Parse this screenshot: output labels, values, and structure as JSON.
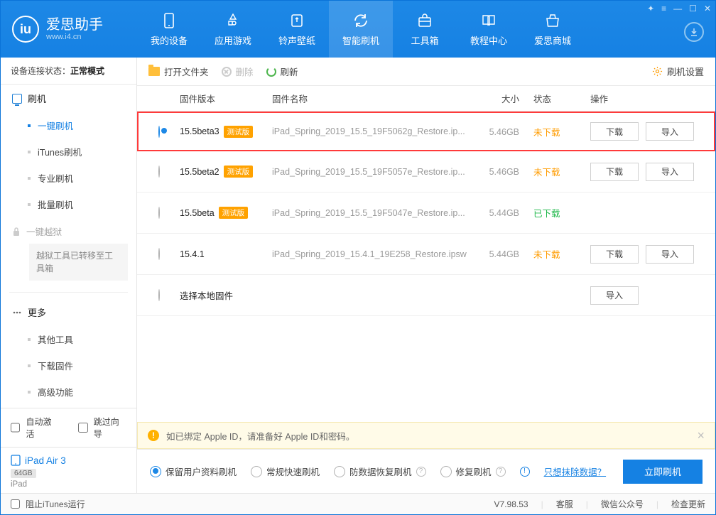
{
  "brand": {
    "cn": "爱思助手",
    "url": "www.i4.cn"
  },
  "nav": {
    "items": [
      {
        "id": "device",
        "label": "我的设备"
      },
      {
        "id": "apps",
        "label": "应用游戏"
      },
      {
        "id": "ring",
        "label": "铃声壁纸"
      },
      {
        "id": "flash",
        "label": "智能刷机"
      },
      {
        "id": "tools",
        "label": "工具箱"
      },
      {
        "id": "tutorial",
        "label": "教程中心"
      },
      {
        "id": "store",
        "label": "爱思商城"
      }
    ],
    "active": "flash"
  },
  "sidebar": {
    "conn_label": "设备连接状态：",
    "conn_value": "正常模式",
    "flash_group": "刷机",
    "items": [
      {
        "id": "onekey",
        "label": "一键刷机"
      },
      {
        "id": "itunes",
        "label": "iTunes刷机"
      },
      {
        "id": "pro",
        "label": "专业刷机"
      },
      {
        "id": "batch",
        "label": "批量刷机"
      }
    ],
    "jailbreak": "一键越狱",
    "jb_note": "越狱工具已转移至工具箱",
    "more": "更多",
    "more_items": [
      {
        "id": "other",
        "label": "其他工具"
      },
      {
        "id": "dlfw",
        "label": "下载固件"
      },
      {
        "id": "adv",
        "label": "高级功能"
      }
    ]
  },
  "auto": {
    "activate": "自动激活",
    "skip": "跳过向导"
  },
  "device": {
    "name": "iPad Air 3",
    "cap": "64GB",
    "model": "iPad"
  },
  "toolbar": {
    "open": "打开文件夹",
    "delete": "删除",
    "refresh": "刷新",
    "settings": "刷机设置"
  },
  "table": {
    "headers": {
      "ver": "固件版本",
      "name": "固件名称",
      "size": "大小",
      "status": "状态",
      "ops": "操作"
    },
    "op_download": "下载",
    "op_import": "导入",
    "local_select": "选择本地固件",
    "badge_beta": "测试版",
    "rows": [
      {
        "ver": "15.5beta3",
        "beta": true,
        "name": "iPad_Spring_2019_15.5_19F5062g_Restore.ip...",
        "size": "5.46GB",
        "status": "未下载",
        "status_class": "p",
        "download": true,
        "import": true,
        "selected": true
      },
      {
        "ver": "15.5beta2",
        "beta": true,
        "name": "iPad_Spring_2019_15.5_19F5057e_Restore.ip...",
        "size": "5.46GB",
        "status": "未下载",
        "status_class": "p",
        "download": true,
        "import": true,
        "selected": false
      },
      {
        "ver": "15.5beta",
        "beta": true,
        "name": "iPad_Spring_2019_15.5_19F5047e_Restore.ip...",
        "size": "5.44GB",
        "status": "已下载",
        "status_class": "d",
        "download": false,
        "import": false,
        "selected": false
      },
      {
        "ver": "15.4.1",
        "beta": false,
        "name": "iPad_Spring_2019_15.4.1_19E258_Restore.ipsw",
        "size": "5.44GB",
        "status": "未下载",
        "status_class": "p",
        "download": true,
        "import": true,
        "selected": false
      }
    ]
  },
  "notice": "如已绑定 Apple ID，请准备好 Apple ID和密码。",
  "options": {
    "keep": "保留用户资料刷机",
    "normal": "常规快速刷机",
    "antidata": "防数据恢复刷机",
    "repair": "修复刷机",
    "erase_link": "只想抹除数据？",
    "flash_btn": "立即刷机"
  },
  "footer": {
    "block_itunes": "阻止iTunes运行",
    "version": "V7.98.53",
    "service": "客服",
    "wechat": "微信公众号",
    "update": "检查更新"
  }
}
